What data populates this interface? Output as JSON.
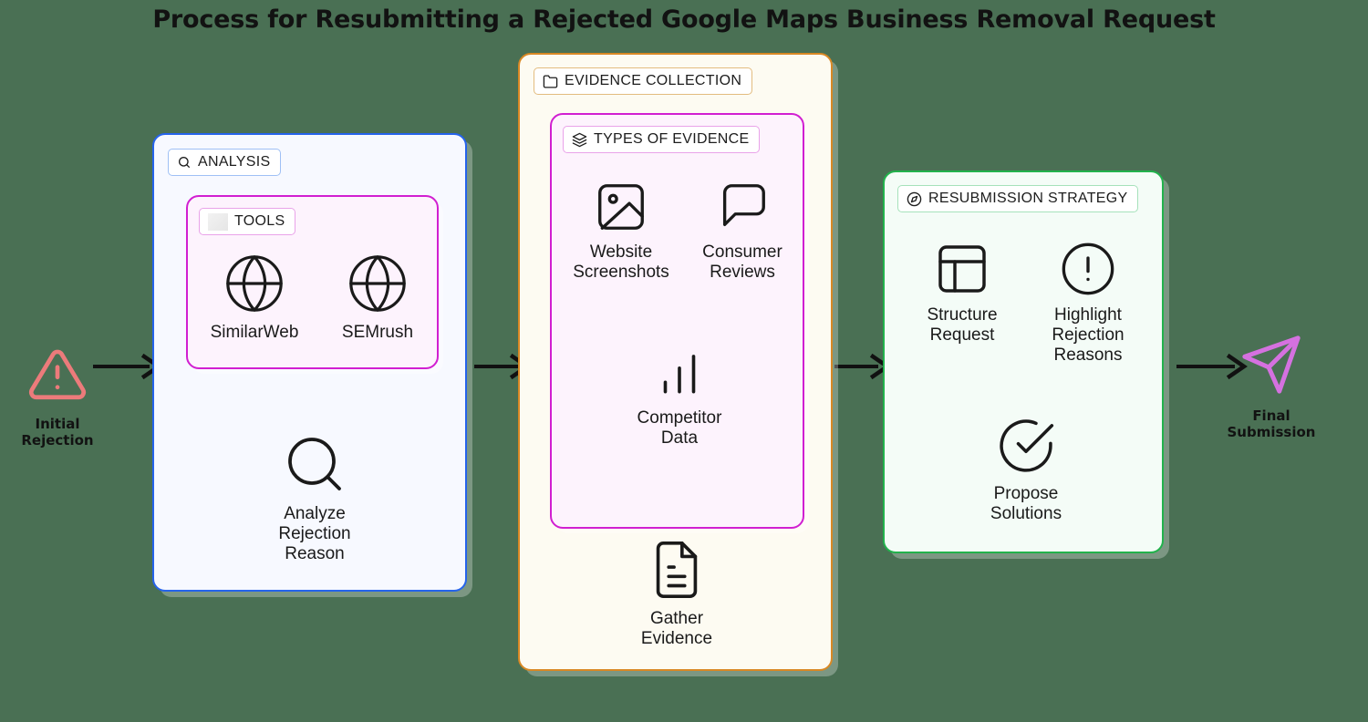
{
  "title": "Process for Resubmitting a Rejected Google Maps Business Removal Request",
  "background_color": "#4a7054",
  "endpoints": {
    "start": {
      "label": "Initial\nRejection",
      "icon": "alert-triangle-icon",
      "color": "#ec7b7b"
    },
    "end": {
      "label": "Final\nSubmission",
      "icon": "send-paper-plane-icon",
      "color": "#d571e0"
    }
  },
  "panels": [
    {
      "id": "analysis",
      "chip_label": "ANALYSIS",
      "chip_icon": "search-icon",
      "border_color": "#2563eb",
      "fill_color": "#f7f9ff",
      "subpanel": {
        "id": "tools",
        "chip_label": "TOOLS",
        "chip_icon": "blank-icon",
        "border_color": "#d11fd1",
        "fill_color": "#fdf3fd",
        "nodes": [
          {
            "label": "SimilarWeb",
            "icon": "globe-icon"
          },
          {
            "label": "SEMrush",
            "icon": "globe-icon"
          }
        ]
      },
      "nodes": [
        {
          "label": "Analyze\nRejection\nReason",
          "icon": "search-icon"
        }
      ]
    },
    {
      "id": "evidence-collection",
      "chip_label": "EVIDENCE COLLECTION",
      "chip_icon": "folder-icon",
      "border_color": "#d98824",
      "fill_color": "#fdfbf2",
      "subpanel": {
        "id": "types-of-evidence",
        "chip_label": "TYPES OF EVIDENCE",
        "chip_icon": "layers-icon",
        "border_color": "#d11fd1",
        "fill_color": "#fdf3fd",
        "nodes": [
          {
            "label": "Website\nScreenshots",
            "icon": "image-icon"
          },
          {
            "label": "Consumer\nReviews",
            "icon": "message-square-icon"
          },
          {
            "label": "Competitor\nData",
            "icon": "bar-chart-icon"
          }
        ]
      },
      "nodes": [
        {
          "label": "Gather\nEvidence",
          "icon": "file-document-icon"
        }
      ]
    },
    {
      "id": "resubmission-strategy",
      "chip_label": "RESUBMISSION STRATEGY",
      "chip_icon": "compass-icon",
      "border_color": "#22b24c",
      "fill_color": "#f4fcf7",
      "subpanel": null,
      "nodes": [
        {
          "label": "Structure\nRequest",
          "icon": "layout-icon"
        },
        {
          "label": "Highlight\nRejection\nReasons",
          "icon": "alert-circle-icon"
        },
        {
          "label": "Propose\nSolutions",
          "icon": "check-circle-icon"
        }
      ]
    }
  ],
  "arrows": [
    {
      "from": "initial-rejection",
      "to": "analysis"
    },
    {
      "from": "analysis",
      "to": "evidence-collection"
    },
    {
      "from": "evidence-collection",
      "to": "resubmission-strategy"
    },
    {
      "from": "resubmission-strategy",
      "to": "final-submission"
    }
  ]
}
